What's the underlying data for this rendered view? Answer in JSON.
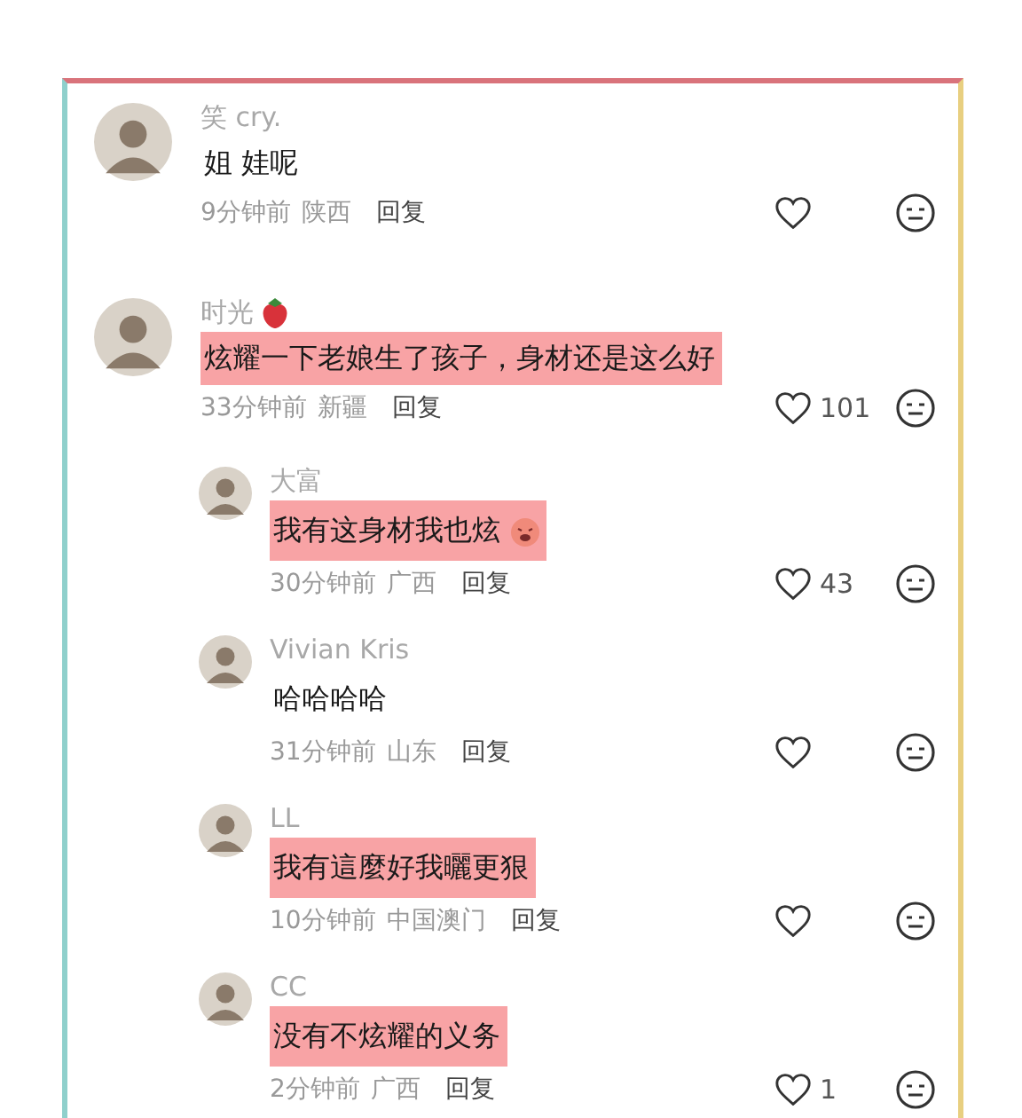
{
  "comments": [
    {
      "name": "笑 cry.",
      "text": "姐  娃呢",
      "highlighted": false,
      "time": "9分钟前",
      "place": "陕西",
      "reply_label": "回复"
    },
    {
      "name": "时光",
      "name_emoji": true,
      "text": "炫耀一下老娘生了孩子，身材还是这么好",
      "highlighted": true,
      "time": "33分钟前",
      "place": "新疆",
      "reply_label": "回复",
      "likes": "101",
      "children": [
        {
          "name": "大富",
          "text": "我有这身材我也炫",
          "text_emoji": true,
          "highlighted": true,
          "time": "30分钟前",
          "place": "广西",
          "reply_label": "回复",
          "likes": "43"
        },
        {
          "name": "Vivian Kris",
          "text": "哈哈哈哈",
          "highlighted": false,
          "time": "31分钟前",
          "place": "山东",
          "reply_label": "回复"
        },
        {
          "name": "LL",
          "text": "我有這麼好我曬更狠",
          "highlighted": true,
          "time": "10分钟前",
          "place": "中国澳门",
          "reply_label": "回复"
        },
        {
          "name": "CC",
          "text": "没有不炫耀的义务",
          "highlighted": true,
          "time": "2分钟前",
          "place": "广西",
          "reply_label": "回复",
          "likes": "1"
        }
      ]
    }
  ]
}
